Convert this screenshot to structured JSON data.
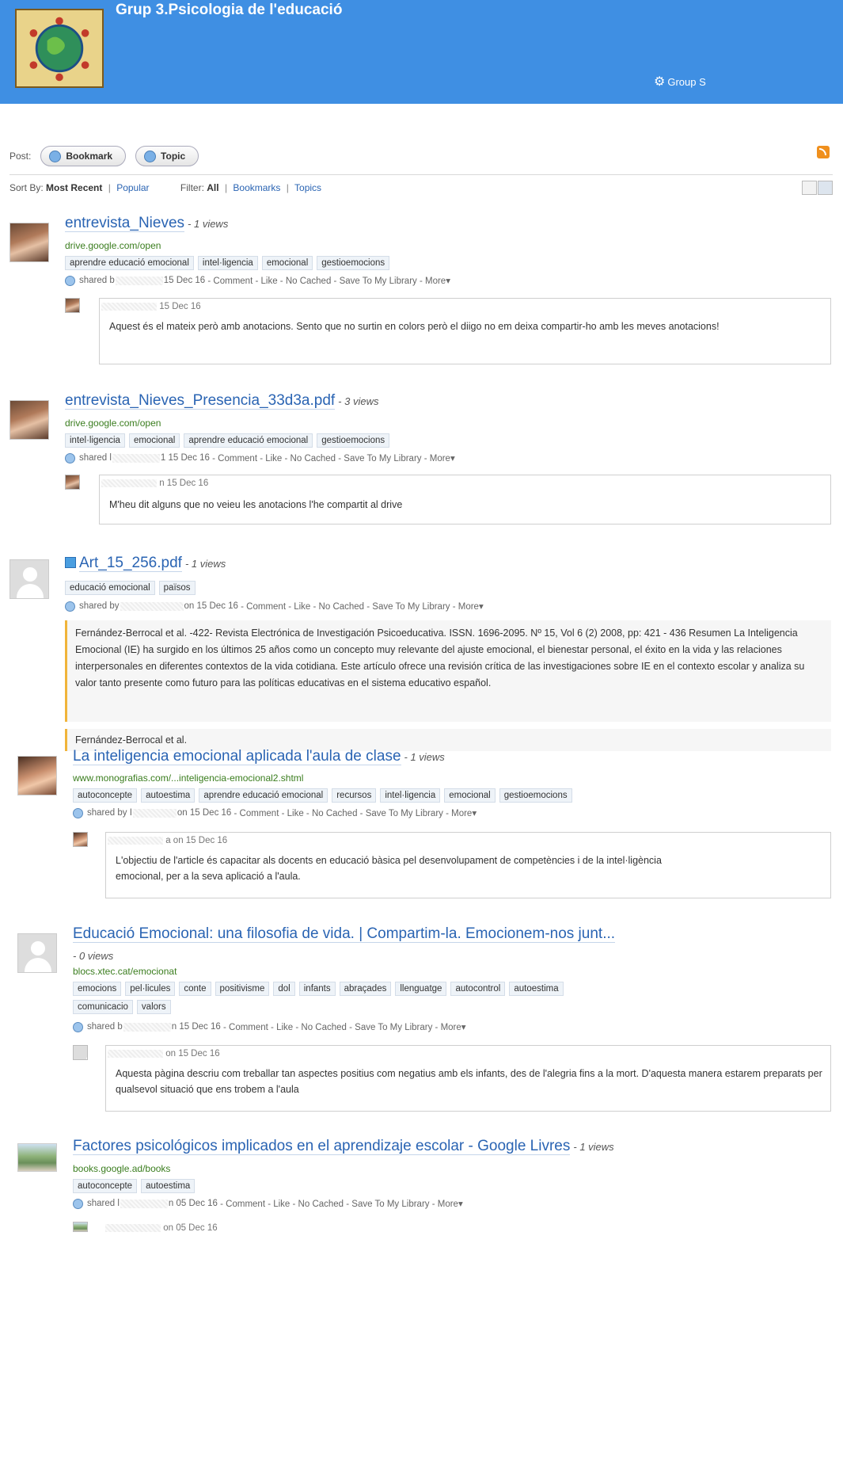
{
  "header": {
    "title": "Grup 3.Psicologia de l'educació",
    "settings_label": "Group S",
    "logo_icon": "globe-logo",
    "background": "#3f8fe3"
  },
  "post_bar": {
    "label": "Post:",
    "bookmark_label": "Bookmark",
    "topic_label": "Topic"
  },
  "sort_bar": {
    "sort_label": "Sort By:",
    "most_recent": "Most Recent",
    "popular": "Popular",
    "filter_label": "Filter:",
    "all": "All",
    "bookmarks": "Bookmarks",
    "topics": "Topics",
    "separator": "|"
  },
  "items": [
    {
      "title": "entrevista_Nieves",
      "views": "- 1 views",
      "url": "drive.google.com/open",
      "tags": [
        "aprendre educació emocional",
        "intel·ligencia",
        "emocional",
        "gestioemocions"
      ],
      "meta_prefix": "shared b",
      "meta_date": "15 Dec 16",
      "actions": "- Comment - Like - No Cached - Save To My Library - More▾",
      "comment_date": "15 Dec 16",
      "comment": "Aquest és el mateix però amb anotacions. Sento que no surtin en colors però el diigo no em deixa compartir-ho amb les meves anotacions!"
    },
    {
      "title": "entrevista_Nieves_Presencia_33d3a.pdf",
      "views": "- 3 views",
      "url": "drive.google.com/open",
      "tags": [
        "intel·ligencia",
        "emocional",
        "aprendre educació emocional",
        "gestioemocions"
      ],
      "meta_prefix": "shared l",
      "meta_date": "1 15 Dec 16",
      "actions": "- Comment - Like - No Cached - Save To My Library - More▾",
      "comment_date": "n 15 Dec 16",
      "comment": "M'heu dit alguns que no veieu les anotacions l'he compartit al drive"
    },
    {
      "title": "Art_15_256.pdf",
      "views": "- 1 views",
      "tags": [
        "educació emocional",
        "països"
      ],
      "meta_prefix": "shared by",
      "meta_date": "on 15 Dec 16",
      "actions": "- Comment - Like - No Cached - Save To My Library - More▾",
      "note": "Fernández-Berrocal et al. -422- Revista Electrónica de Investigación Psicoeducativa. ISSN. 1696-2095. Nº 15, Vol 6 (2) 2008, pp: 421 - 436 Resumen La Inteligencia Emocional (IE) ha surgido en los últimos 25 años como un concepto muy relevante del ajuste emocional, el bienestar personal, el éxito en la vida y las relaciones interpersonales en diferentes contextos de la vida cotidiana. Este artículo ofrece una revisión crítica de las investigaciones sobre IE en el contexto escolar y analiza su valor tanto presente como futuro para las políticas educativas en el sistema educativo español.",
      "note2": "Fernández-Berrocal et al."
    },
    {
      "title": "La inteligencia emocional aplicada l'aula de clase",
      "views": "- 1 views",
      "url": "www.monografias.com/...inteligencia-emocional2.shtml",
      "tags": [
        "autoconcepte",
        "autoestima",
        "aprendre educació emocional",
        "recursos",
        "intel·ligencia",
        "emocional",
        "gestioemocions"
      ],
      "meta_prefix": "shared by I",
      "meta_date": "on 15 Dec 16",
      "actions": "- Comment - Like - No Cached - Save To My Library - More▾",
      "comment_date": "a on 15 Dec 16",
      "comment": "L'objectiu de l'article és capacitar als docents en educació bàsica pel desenvolupament de competències i de la intel·ligència emocional, per a la seva aplicació a l'aula."
    },
    {
      "title": "Educació Emocional: una filosofia de vida. | Compartim-la. Emocionem-nos junt...",
      "views": "- 0 views",
      "url": "blocs.xtec.cat/emocionat",
      "tags_line1": [
        "emocions",
        "pel·licules",
        "conte",
        "positivisme",
        "dol",
        "infants",
        "abraçades",
        "llenguatge",
        "autocontrol",
        "autoestima"
      ],
      "tags_line2": [
        "comunicacio",
        "valors"
      ],
      "meta_prefix": "shared b",
      "meta_date": "n 15 Dec 16",
      "actions": "- Comment - Like - No Cached - Save To My Library - More▾",
      "comment_date": "on 15 Dec 16",
      "comment": "Aquesta pàgina descriu com treballar tan aspectes positius com negatius amb els infants, des de l'alegria fins a la mort. D'aquesta manera estarem preparats per qualsevol situació que ens trobem a l'aula"
    },
    {
      "title": "Factores psicológicos implicados en el aprendizaje escolar - Google Livres",
      "views": "- 1 views",
      "url": "books.google.ad/books",
      "tags": [
        "autoconcepte",
        "autoestima"
      ],
      "meta_prefix": "shared l",
      "meta_date": "n 05 Dec 16",
      "actions": "- Comment - Like - No Cached - Save To My Library - More▾",
      "comment_date": "on 05 Dec 16"
    }
  ]
}
